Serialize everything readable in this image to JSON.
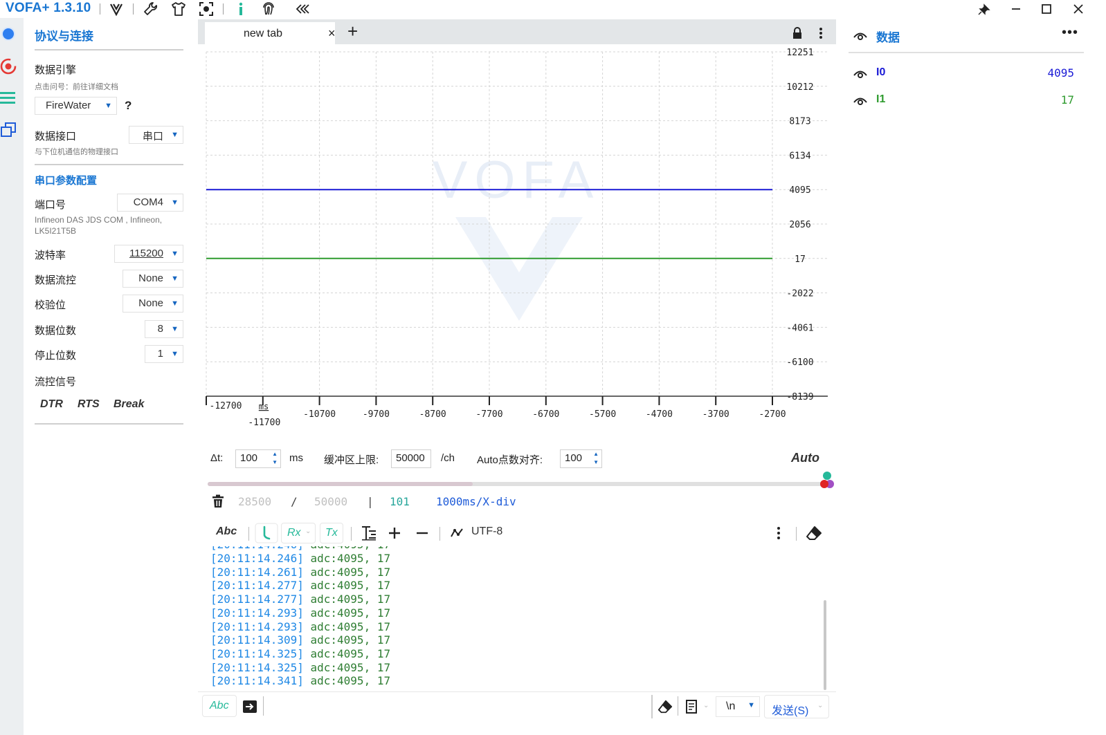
{
  "app": {
    "title": "VOFA+ 1.3.10",
    "toolbar_icons": [
      "vofa-logo-icon",
      "wrench-icon",
      "shirt-icon",
      "screenshot-icon",
      "info-icon",
      "fingerprint-icon",
      "collapse-icon"
    ],
    "window_controls": [
      "pin-icon",
      "minimize-icon",
      "maximize-icon",
      "close-icon"
    ]
  },
  "rail": {
    "items": [
      "connection-icon",
      "record-icon",
      "list-icon",
      "windows-icon"
    ]
  },
  "panel": {
    "title": "协议与连接",
    "engine_label": "数据引擎",
    "engine_hint": "点击问号：前往详细文档",
    "engine_value": "FireWater",
    "engine_help": "?",
    "interface_label": "数据接口",
    "interface_value": "串口",
    "interface_hint": "与下位机通信的物理接口",
    "serial_title": "串口参数配置",
    "port_label": "端口号",
    "port_value": "COM4",
    "port_hint": "Infineon DAS JDS COM , Infineon, LK5I21T5B",
    "baud_label": "波特率",
    "baud_value": "115200",
    "flow_label": "数据流控",
    "flow_value": "None",
    "parity_label": "校验位",
    "parity_value": "None",
    "databits_label": "数据位数",
    "databits_value": "8",
    "stopbits_label": "停止位数",
    "stopbits_value": "1",
    "flowsig_label": "流控信号",
    "flow_buttons": [
      "DTR",
      "RTS",
      "Break"
    ]
  },
  "tabs": {
    "active": "new tab",
    "close": "×",
    "add": "+"
  },
  "chart_data": {
    "type": "line",
    "watermark": "VOFA",
    "x_ticks": [
      -12700,
      -11700,
      -10700,
      -9700,
      -8700,
      -7700,
      -6700,
      -5700,
      -4700,
      -3700,
      -2700
    ],
    "x_unit": "ms",
    "y_ticks": [
      12251,
      10212,
      8173,
      6134,
      4095,
      2056,
      17,
      -2022,
      -4061,
      -6100,
      -8139
    ],
    "xlim": [
      -12700,
      -2700
    ],
    "ylim": [
      -8139,
      12251
    ],
    "grid": true,
    "series": [
      {
        "name": "I0",
        "color": "#1a1ad6",
        "x": [
          -12700,
          -2700
        ],
        "values": [
          4095,
          4095
        ]
      },
      {
        "name": "I1",
        "color": "#2e9b2e",
        "x": [
          -12700,
          -2700
        ],
        "values": [
          17,
          17
        ]
      }
    ]
  },
  "controls": {
    "dt_label": "Δt:",
    "dt_value": "100",
    "dt_unit": "ms",
    "buffer_label": "缓冲区上限:",
    "buffer_value": "50000",
    "buffer_unit": "/ch",
    "auto_points_label": "Auto点数对齐:",
    "auto_points_value": "100",
    "auto_button": "Auto",
    "slider_fraction": 0.43
  },
  "stats": {
    "count": "28500",
    "slash": "/",
    "limit": "50000",
    "bar": "|",
    "fps": "101",
    "scale": "1000ms/X-div"
  },
  "console_toolbar": {
    "abc": "Abc",
    "rx": "Rx",
    "tx": "Tx",
    "encoding": "UTF-8"
  },
  "console": {
    "lines": [
      {
        "ts": "[20:11:14.246]",
        "msg": "adc:4095, 17"
      },
      {
        "ts": "[20:11:14.261]",
        "msg": "adc:4095, 17"
      },
      {
        "ts": "[20:11:14.277]",
        "msg": "adc:4095, 17"
      },
      {
        "ts": "[20:11:14.277]",
        "msg": "adc:4095, 17"
      },
      {
        "ts": "[20:11:14.293]",
        "msg": "adc:4095, 17"
      },
      {
        "ts": "[20:11:14.293]",
        "msg": "adc:4095, 17"
      },
      {
        "ts": "[20:11:14.309]",
        "msg": "adc:4095, 17"
      },
      {
        "ts": "[20:11:14.325]",
        "msg": "adc:4095, 17"
      },
      {
        "ts": "[20:11:14.325]",
        "msg": "adc:4095, 17"
      },
      {
        "ts": "[20:11:14.341]",
        "msg": "adc:4095, 17"
      }
    ]
  },
  "sendbar": {
    "abc": "Abc",
    "newline": "\\n",
    "send": "发送(S)"
  },
  "data_panel": {
    "title": "数据",
    "more": "•••",
    "channels": [
      {
        "name": "I0",
        "value": "4095",
        "color": "#1a1ad6"
      },
      {
        "name": "I1",
        "value": "17",
        "color": "#2e9b2e"
      }
    ]
  }
}
